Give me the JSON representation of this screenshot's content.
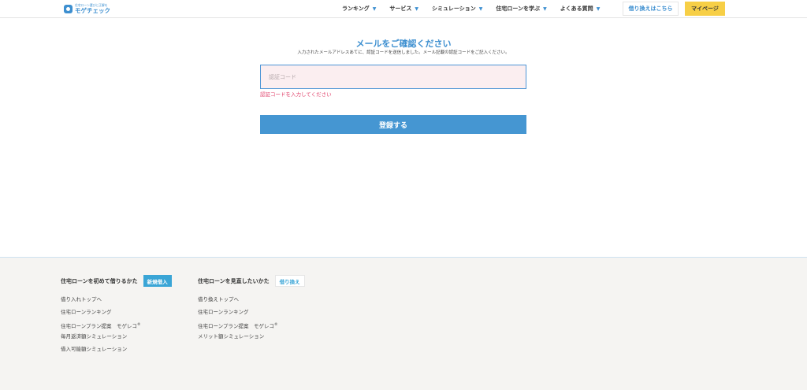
{
  "header": {
    "logo_sub": "住宅ローン選びに正解を",
    "logo_main": "モゲチェック",
    "nav": [
      {
        "label": "ランキング"
      },
      {
        "label": "サービス"
      },
      {
        "label": "シミュレーション"
      },
      {
        "label": "住宅ローンを学ぶ"
      },
      {
        "label": "よくある質問"
      }
    ],
    "refinance_label": "借り換えはこちら",
    "mypage_label": "マイページ"
  },
  "main": {
    "title": "メールをご確認ください",
    "subtitle": "入力されたメールアドレスあてに、認証コードを送信しました。メール記載の認証コードをご記入ください。",
    "code_placeholder": "認証コード",
    "error": "認証コードを入力してください",
    "submit_label": "登録する"
  },
  "footer": {
    "columns": [
      {
        "title": "住宅ローンを初めて借りるかた",
        "tag": "新規借入",
        "links": [
          "借り入れトップへ",
          "住宅ローンランキング",
          "住宅ローンプラン提案　モゲレコ",
          "毎月返済額シミュレーション",
          "借入可能額シミュレーション"
        ]
      },
      {
        "title": "住宅ローンを見直したいかた",
        "tag": "借り換え",
        "links": [
          "借り換えトップへ",
          "住宅ローンランキング",
          "住宅ローンプラン提案　モゲレコ",
          "メリット額シミュレーション"
        ]
      }
    ],
    "registered_mark": "®"
  },
  "colors": {
    "accent": "#3d8fd0",
    "button": "#4596d2",
    "mypage": "#f7cf46",
    "error": "#e0406a",
    "input_bg": "#fbeef0",
    "footer_bg": "#f5f4f2"
  }
}
